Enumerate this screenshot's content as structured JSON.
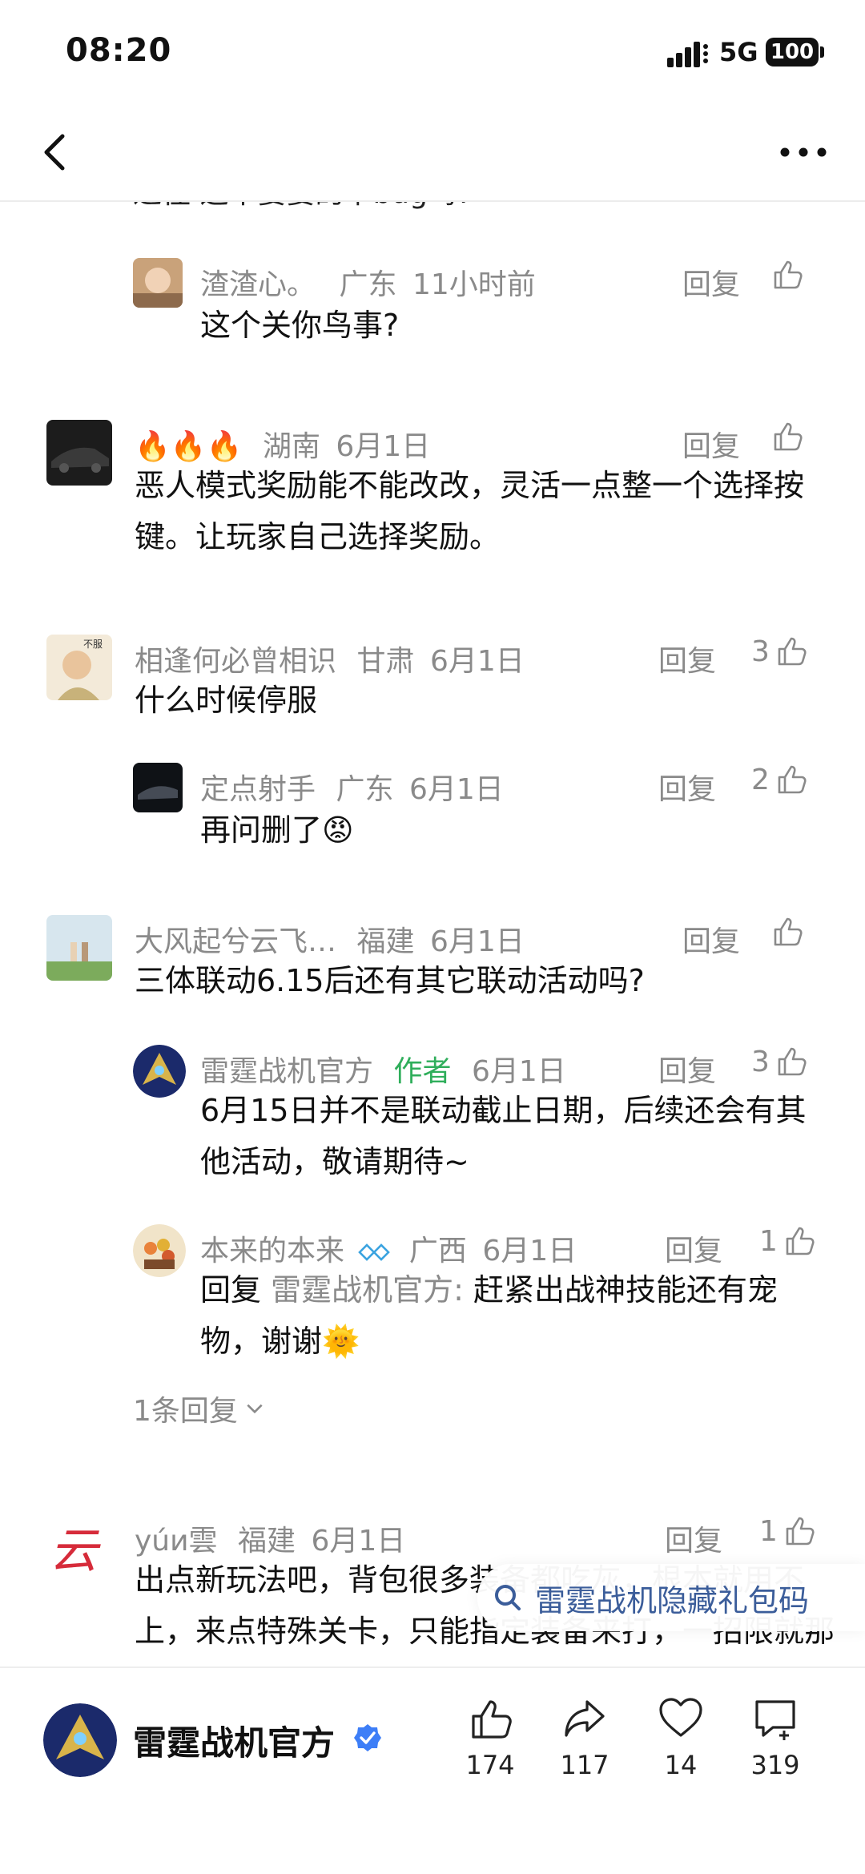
{
  "status": {
    "time": "08:20",
    "network": "5G",
    "battery": "100"
  },
  "comments": [
    {
      "id": "c1",
      "level": "reply",
      "user": "渣渣心。",
      "location": "广东",
      "time": "11小时前",
      "reply_label": "回复",
      "likes": "",
      "text": "这个关你鸟事?"
    },
    {
      "id": "c2",
      "level": "top",
      "user": "🔥🔥🔥",
      "location": "湖南",
      "time": "6月1日",
      "reply_label": "回复",
      "likes": "",
      "text": "恶人模式奖励能不能改改，灵活一点整一个选择按键。让玩家自己选择奖励。"
    },
    {
      "id": "c3",
      "level": "top",
      "user": "相逢何必曾相识",
      "location": "甘肃",
      "time": "6月1日",
      "reply_label": "回复",
      "likes": "3",
      "text": "什么时候停服"
    },
    {
      "id": "c4",
      "level": "reply",
      "user": "定点射手",
      "location": "广东",
      "time": "6月1日",
      "reply_label": "回复",
      "likes": "2",
      "text": "再问删了😡"
    },
    {
      "id": "c5",
      "level": "top",
      "user": "大风起兮云飞…",
      "location": "福建",
      "time": "6月1日",
      "reply_label": "回复",
      "likes": "",
      "text": "三体联动6.15后还有其它联动活动吗?"
    },
    {
      "id": "c6",
      "level": "reply",
      "user": "雷霆战机官方",
      "author_tag": "作者",
      "time": "6月1日",
      "reply_label": "回复",
      "likes": "3",
      "text": "6月15日并不是联动截止日期，后续还会有其他活动，敬请期待~"
    },
    {
      "id": "c7",
      "level": "reply",
      "user": "本来的本来",
      "location": "广西",
      "time": "6月1日",
      "reply_label": "回复",
      "likes": "1",
      "quote_prefix": "回复 ",
      "quote_target": "雷霆战机官方:",
      "text": " 赶紧出战神技能还有宠物，谢谢🌞"
    },
    {
      "id": "c8",
      "level": "top",
      "user": "yúи雲",
      "location": "福建",
      "time": "6月1日",
      "reply_label": "回复",
      "likes": "1",
      "text": "出点新玩法吧，背包很多装备都吃灰，根本就用不上，来点特殊关卡，只能指定装备来打，一招限就那么几套"
    }
  ],
  "clipped_top_text": "过往 这不要要的卡bug吗?",
  "more_replies": "1条回复",
  "search_suggestion": "雷霆战机隐藏礼包码",
  "channel": {
    "name": "雷霆战机官方",
    "verified": true
  },
  "actions": {
    "like": "174",
    "share": "117",
    "favorite": "14",
    "comment": "319"
  },
  "colors": {
    "author_tag": "#2fae5b",
    "meta": "#8a8a8a",
    "search": "#3b5d9a",
    "verified": "#3d7ef7"
  }
}
